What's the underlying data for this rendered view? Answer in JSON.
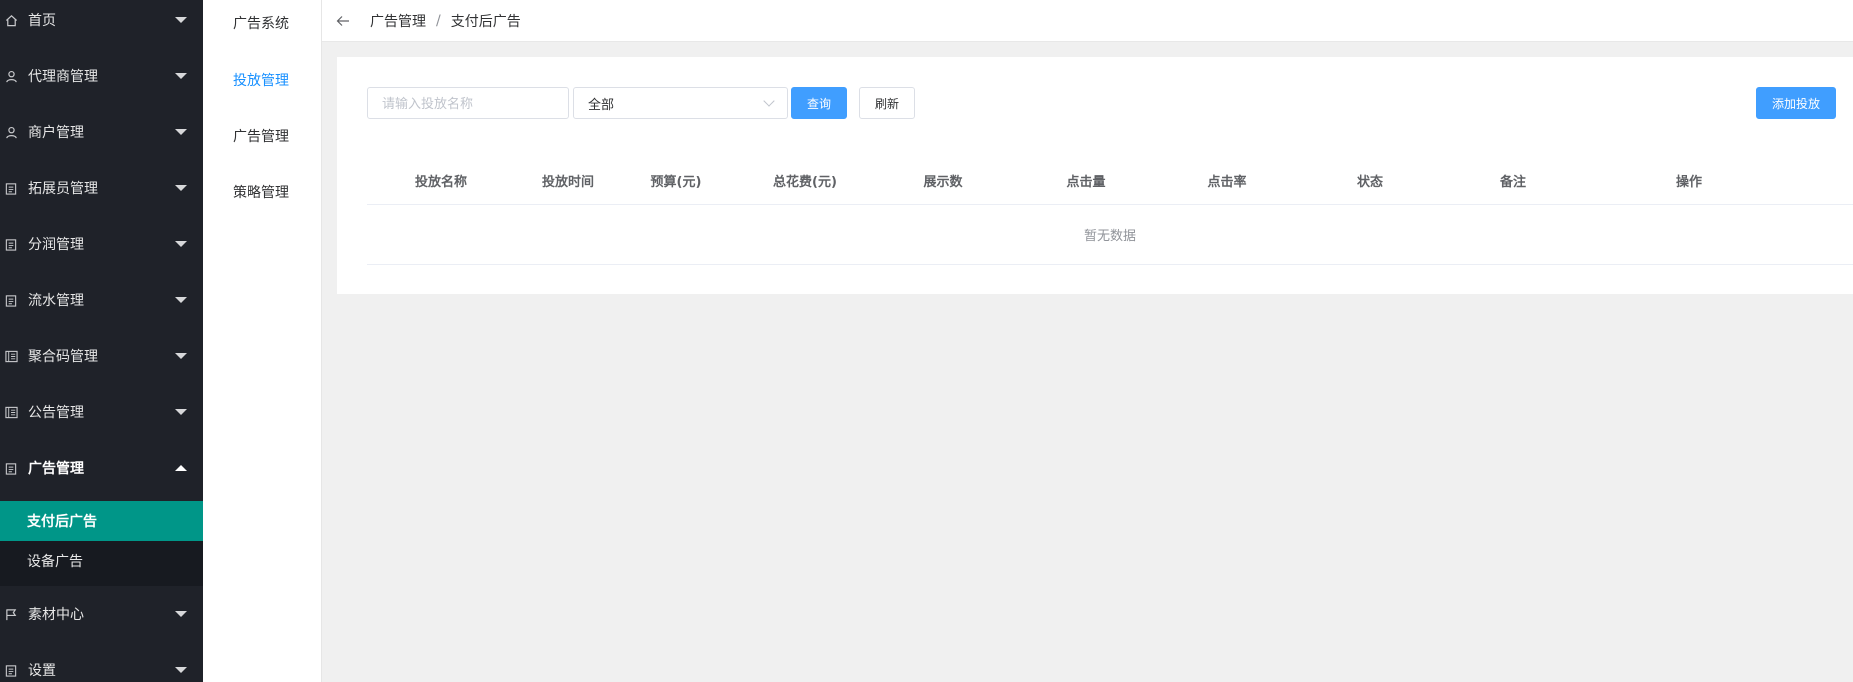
{
  "sidebar": {
    "items": [
      {
        "label": "首页",
        "icon": "home-icon"
      },
      {
        "label": "代理商管理",
        "icon": "user-icon"
      },
      {
        "label": "商户管理",
        "icon": "user-icon"
      },
      {
        "label": "拓展员管理",
        "icon": "clipboard-icon"
      },
      {
        "label": "分润管理",
        "icon": "clipboard-icon"
      },
      {
        "label": "流水管理",
        "icon": "clipboard-icon"
      },
      {
        "label": "聚合码管理",
        "icon": "document-icon"
      },
      {
        "label": "公告管理",
        "icon": "document-icon"
      },
      {
        "label": "广告管理",
        "icon": "clipboard-icon",
        "expanded": true
      },
      {
        "label": "素材中心",
        "icon": "flag-icon"
      },
      {
        "label": "设置",
        "icon": "clipboard-icon"
      }
    ],
    "submenu": [
      {
        "label": "支付后广告",
        "active": true
      },
      {
        "label": "设备广告"
      }
    ]
  },
  "subnav": {
    "items": [
      {
        "label": "广告系统"
      },
      {
        "label": "投放管理",
        "active": true
      },
      {
        "label": "广告管理"
      },
      {
        "label": "策略管理"
      }
    ]
  },
  "breadcrumb": {
    "parent": "广告管理",
    "separator": "/",
    "current": "支付后广告"
  },
  "filters": {
    "name_placeholder": "请输入投放名称",
    "name_value": "",
    "status_value": "全部"
  },
  "buttons": {
    "query": "查询",
    "refresh": "刷新",
    "add": "添加投放"
  },
  "table": {
    "columns": [
      "投放名称",
      "投放时间",
      "预算(元)",
      "总花费(元)",
      "展示数",
      "点击量",
      "点击率",
      "状态",
      "备注",
      "操作"
    ],
    "rows": [],
    "empty_text": "暂无数据"
  },
  "colors": {
    "sidebar_bg": "#1f2229",
    "active_submenu": "#009688",
    "primary": "#409eff",
    "active_link": "#1890ff"
  }
}
